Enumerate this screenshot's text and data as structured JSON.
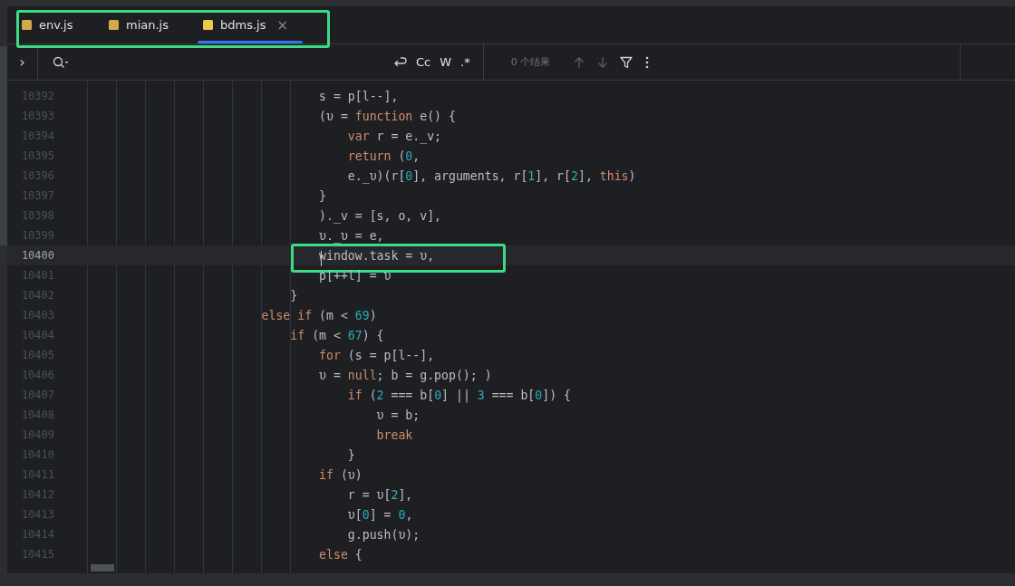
{
  "tabs": {
    "boxed": true,
    "items": [
      {
        "label": "env.js",
        "selected": false
      },
      {
        "label": "mian.js",
        "selected": false
      },
      {
        "label": "bdms.js",
        "selected": true,
        "close": "×"
      }
    ]
  },
  "search_bar": {
    "expand": "›",
    "match_case": "Cc",
    "whole_word": "W",
    "regex": ".*",
    "result": "0 个结果"
  },
  "editor": {
    "lines": [
      {
        "number": "10392",
        "current": false,
        "boxed": false,
        "tokens": [
          {
            "kind": "plain",
            "text": "                                s = p[l--],"
          }
        ]
      },
      {
        "number": "10393",
        "current": false,
        "boxed": false,
        "tokens": [
          {
            "kind": "plain",
            "text": "                                (υ = "
          },
          {
            "kind": "keyword",
            "text": "function"
          },
          {
            "kind": "plain",
            "text": " e() {"
          }
        ]
      },
      {
        "number": "10394",
        "current": false,
        "boxed": false,
        "tokens": [
          {
            "kind": "keyword",
            "text": "                                    var"
          },
          {
            "kind": "plain",
            "text": " r = e._v;"
          }
        ]
      },
      {
        "number": "10395",
        "current": false,
        "boxed": false,
        "tokens": [
          {
            "kind": "keyword",
            "text": "                                    return"
          },
          {
            "kind": "plain",
            "text": " ("
          },
          {
            "kind": "number",
            "text": "0"
          },
          {
            "kind": "plain",
            "text": ","
          }
        ]
      },
      {
        "number": "10396",
        "current": false,
        "boxed": false,
        "tokens": [
          {
            "kind": "plain",
            "text": "                                    e._υ)(r["
          },
          {
            "kind": "number",
            "text": "0"
          },
          {
            "kind": "plain",
            "text": "], arguments, r["
          },
          {
            "kind": "number",
            "text": "1"
          },
          {
            "kind": "plain",
            "text": "], r["
          },
          {
            "kind": "number",
            "text": "2"
          },
          {
            "kind": "plain",
            "text": "], "
          },
          {
            "kind": "keyword",
            "text": "this"
          },
          {
            "kind": "plain",
            "text": ")"
          }
        ]
      },
      {
        "number": "10397",
        "current": false,
        "boxed": false,
        "tokens": [
          {
            "kind": "plain",
            "text": "                                }"
          }
        ]
      },
      {
        "number": "10398",
        "current": false,
        "boxed": false,
        "tokens": [
          {
            "kind": "plain",
            "text": "                                )._v = [s, o, v],"
          }
        ]
      },
      {
        "number": "10399",
        "current": false,
        "boxed": false,
        "tokens": [
          {
            "kind": "plain",
            "text": "                                υ._υ = e,"
          }
        ]
      },
      {
        "number": "10400",
        "current": true,
        "boxed": true,
        "tokens": [
          {
            "kind": "plain",
            "text": "                                window.task = υ,"
          }
        ]
      },
      {
        "number": "10401",
        "current": false,
        "boxed": false,
        "tokens": [
          {
            "kind": "plain",
            "text": "                                p[++l] = υ"
          }
        ]
      },
      {
        "number": "10402",
        "current": false,
        "boxed": false,
        "tokens": [
          {
            "kind": "plain",
            "text": "                            }"
          }
        ]
      },
      {
        "number": "10403",
        "current": false,
        "boxed": false,
        "tokens": [
          {
            "kind": "keyword",
            "text": "                        else if"
          },
          {
            "kind": "plain",
            "text": " (m < "
          },
          {
            "kind": "number",
            "text": "69"
          },
          {
            "kind": "plain",
            "text": ")"
          }
        ]
      },
      {
        "number": "10404",
        "current": false,
        "boxed": false,
        "tokens": [
          {
            "kind": "keyword",
            "text": "                            if"
          },
          {
            "kind": "plain",
            "text": " (m < "
          },
          {
            "kind": "number",
            "text": "67"
          },
          {
            "kind": "plain",
            "text": ") {"
          }
        ]
      },
      {
        "number": "10405",
        "current": false,
        "boxed": false,
        "tokens": [
          {
            "kind": "keyword",
            "text": "                                for"
          },
          {
            "kind": "plain",
            "text": " (s = p[l--],"
          }
        ]
      },
      {
        "number": "10406",
        "current": false,
        "boxed": false,
        "tokens": [
          {
            "kind": "plain",
            "text": "                                υ = "
          },
          {
            "kind": "keyword",
            "text": "null"
          },
          {
            "kind": "plain",
            "text": "; b = g.pop(); )"
          }
        ]
      },
      {
        "number": "10407",
        "current": false,
        "boxed": false,
        "tokens": [
          {
            "kind": "keyword",
            "text": "                                    if"
          },
          {
            "kind": "plain",
            "text": " ("
          },
          {
            "kind": "number",
            "text": "2"
          },
          {
            "kind": "plain",
            "text": " === b["
          },
          {
            "kind": "number",
            "text": "0"
          },
          {
            "kind": "plain",
            "text": "] || "
          },
          {
            "kind": "number",
            "text": "3"
          },
          {
            "kind": "plain",
            "text": " === b["
          },
          {
            "kind": "number",
            "text": "0"
          },
          {
            "kind": "plain",
            "text": "]) {"
          }
        ]
      },
      {
        "number": "10408",
        "current": false,
        "boxed": false,
        "tokens": [
          {
            "kind": "plain",
            "text": "                                        υ = b;"
          }
        ]
      },
      {
        "number": "10409",
        "current": false,
        "boxed": false,
        "tokens": [
          {
            "kind": "keyword",
            "text": "                                        break"
          }
        ]
      },
      {
        "number": "10410",
        "current": false,
        "boxed": false,
        "tokens": [
          {
            "kind": "plain",
            "text": "                                    }"
          }
        ]
      },
      {
        "number": "10411",
        "current": false,
        "boxed": false,
        "tokens": [
          {
            "kind": "keyword",
            "text": "                                if"
          },
          {
            "kind": "plain",
            "text": " (υ)"
          }
        ]
      },
      {
        "number": "10412",
        "current": false,
        "boxed": false,
        "tokens": [
          {
            "kind": "plain",
            "text": "                                    r = υ["
          },
          {
            "kind": "number",
            "text": "2"
          },
          {
            "kind": "plain",
            "text": "],"
          }
        ]
      },
      {
        "number": "10413",
        "current": false,
        "boxed": false,
        "tokens": [
          {
            "kind": "plain",
            "text": "                                    υ["
          },
          {
            "kind": "number",
            "text": "0"
          },
          {
            "kind": "plain",
            "text": "] = "
          },
          {
            "kind": "number",
            "text": "0"
          },
          {
            "kind": "plain",
            "text": ","
          }
        ]
      },
      {
        "number": "10414",
        "current": false,
        "boxed": false,
        "tokens": [
          {
            "kind": "plain",
            "text": "                                    g.push(υ);"
          }
        ]
      },
      {
        "number": "10415",
        "current": false,
        "boxed": false,
        "tokens": [
          {
            "kind": "keyword",
            "text": "                                else"
          },
          {
            "kind": "plain",
            "text": " {"
          }
        ]
      }
    ]
  }
}
